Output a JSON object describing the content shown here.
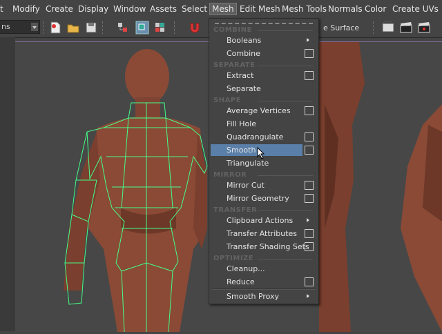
{
  "menubar": {
    "items": [
      "t",
      "Modify",
      "Create",
      "Display",
      "Window",
      "Assets",
      "Select",
      "Mesh",
      "Edit Mesh",
      "Mesh Tools",
      "Normals",
      "Color",
      "Create UVs"
    ],
    "active": "Mesh"
  },
  "toolbar": {
    "mode_value": "ns",
    "right_label": "e Surface"
  },
  "mesh_menu": {
    "sections": {
      "combine": "COMBINE",
      "separate": "SEPARATE",
      "shape": "SHAPE",
      "mirror": "MIRROR",
      "transfer": "TRANSFER",
      "optimize": "OPTIMIZE"
    },
    "items": {
      "booleans": "Booleans",
      "combine": "Combine",
      "extract": "Extract",
      "separate": "Separate",
      "average_vertices": "Average Vertices",
      "fill_hole": "Fill Hole",
      "quadrangulate": "Quadrangulate",
      "smooth": "Smooth",
      "triangulate": "Triangulate",
      "mirror_cut": "Mirror Cut",
      "mirror_geometry": "Mirror Geometry",
      "clipboard_actions": "Clipboard Actions",
      "transfer_attributes": "Transfer Attributes",
      "transfer_shading_sets": "Transfer Shading Sets",
      "cleanup": "Cleanup...",
      "reduce": "Reduce",
      "smooth_proxy": "Smooth Proxy"
    },
    "highlighted": "Smooth"
  },
  "colors": {
    "accent": "#5a7fa8",
    "wireframe": "#44ff88",
    "skin": "#8a4a36"
  }
}
